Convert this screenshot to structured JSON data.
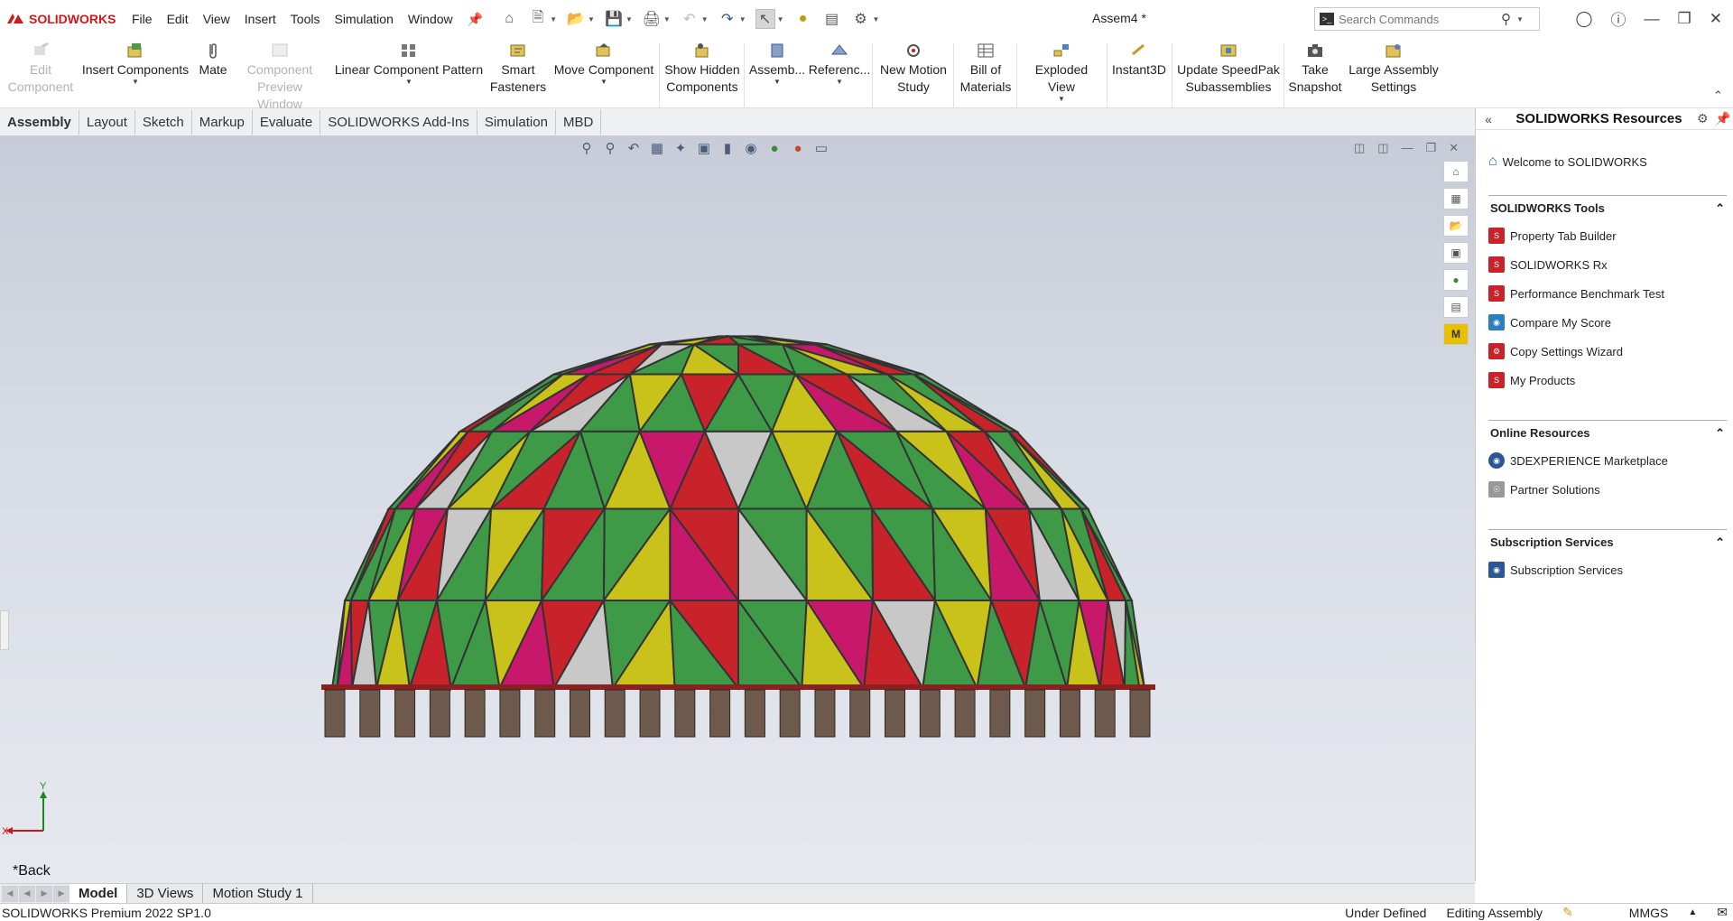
{
  "app": {
    "brand": "SOLIDWORKS",
    "document_title": "Assem4 *"
  },
  "menu": [
    "File",
    "Edit",
    "View",
    "Insert",
    "Tools",
    "Simulation",
    "Window"
  ],
  "search": {
    "placeholder": "Search Commands"
  },
  "ribbon": {
    "edit_component": [
      "Edit",
      "Component"
    ],
    "insert_components": "Insert Components",
    "mate": "Mate",
    "component_preview": [
      "Component",
      "Preview Window"
    ],
    "linear_pattern": "Linear Component Pattern",
    "smart_fasteners": [
      "Smart",
      "Fasteners"
    ],
    "move_component": "Move Component",
    "show_hidden": [
      "Show Hidden",
      "Components"
    ],
    "assembly": "Assemb...",
    "reference": "Referenc...",
    "new_motion": [
      "New Motion",
      "Study"
    ],
    "bom": [
      "Bill of",
      "Materials"
    ],
    "exploded": "Exploded View",
    "instant3d": "Instant3D",
    "speedpak": [
      "Update SpeedPak",
      "Subassemblies"
    ],
    "snapshot": [
      "Take",
      "Snapshot"
    ],
    "large_assembly": [
      "Large Assembly",
      "Settings"
    ]
  },
  "tabs": [
    "Assembly",
    "Layout",
    "Sketch",
    "Markup",
    "Evaluate",
    "SOLIDWORKS Add-Ins",
    "Simulation",
    "MBD"
  ],
  "viewport": {
    "view_label": "*Back",
    "triad_x": "X",
    "triad_y": "Y"
  },
  "taskpane": {
    "title": "SOLIDWORKS Resources",
    "welcome": "Welcome to SOLIDWORKS",
    "tools_title": "SOLIDWORKS Tools",
    "tools": [
      "Property Tab Builder",
      "SOLIDWORKS Rx",
      "Performance Benchmark Test",
      "Compare My Score",
      "Copy Settings Wizard",
      "My Products"
    ],
    "online_title": "Online Resources",
    "online": [
      "3DEXPERIENCE Marketplace",
      "Partner Solutions"
    ],
    "subscription_title": "Subscription Services",
    "subscription": [
      "Subscription Services"
    ]
  },
  "bottom_tabs": [
    "Model",
    "3D Views",
    "Motion Study 1"
  ],
  "status": {
    "version": "SOLIDWORKS Premium 2022 SP1.0",
    "defined": "Under Defined",
    "mode": "Editing Assembly",
    "units": "MMGS"
  },
  "colors": {
    "red": "#c8232a",
    "green": "#3f9a48",
    "yellow": "#c8c21a",
    "magenta": "#c8186c",
    "gray": "#c8c8c8",
    "base": "#6e5a4c"
  }
}
